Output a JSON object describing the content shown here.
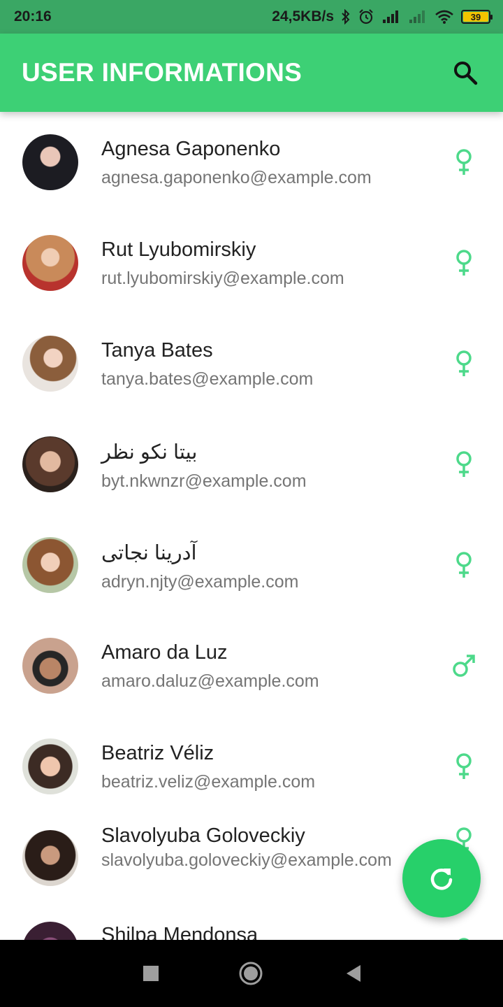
{
  "status_bar": {
    "time": "20:16",
    "network_speed": "24,5KB/s",
    "battery_level": "39",
    "icons": [
      "bluetooth-icon",
      "alarm-icon",
      "signal-icon",
      "signal-icon",
      "wifi-icon",
      "battery-icon"
    ]
  },
  "app_bar": {
    "title": "USER INFORMATIONS",
    "search_icon": "search-icon"
  },
  "colors": {
    "status_bar": "#3aa764",
    "app_bar": "#3dd075",
    "accent": "#4dd98a",
    "fab": "#27d06a",
    "name_text": "#222222",
    "email_text": "#757575"
  },
  "users": [
    {
      "name": "Agnesa Gaponenko",
      "email": "agnesa.gaponenko@example.com",
      "gender": "female"
    },
    {
      "name": "Rut Lyubomirskiy",
      "email": "rut.lyubomirskiy@example.com",
      "gender": "female"
    },
    {
      "name": "Tanya Bates",
      "email": "tanya.bates@example.com",
      "gender": "female"
    },
    {
      "name": "بیتا نکو نظر",
      "email": "byt.nkwnzr@example.com",
      "gender": "female"
    },
    {
      "name": "آدرینا نجاتی",
      "email": "adryn.njty@example.com",
      "gender": "female"
    },
    {
      "name": "Amaro da Luz",
      "email": "amaro.daluz@example.com",
      "gender": "male"
    },
    {
      "name": "Beatriz Véliz",
      "email": "beatriz.veliz@example.com",
      "gender": "female"
    },
    {
      "name": "Slavolyuba Goloveckiy",
      "email": "slavolyuba.goloveckiy@example.com",
      "gender": "female"
    },
    {
      "name": "Shilpa Mendonsa",
      "email": "",
      "gender": "female"
    }
  ],
  "fab": {
    "icon": "refresh-icon"
  },
  "nav_bar": {
    "icons": [
      "recents-square-icon",
      "home-circle-icon",
      "back-triangle-icon"
    ]
  }
}
